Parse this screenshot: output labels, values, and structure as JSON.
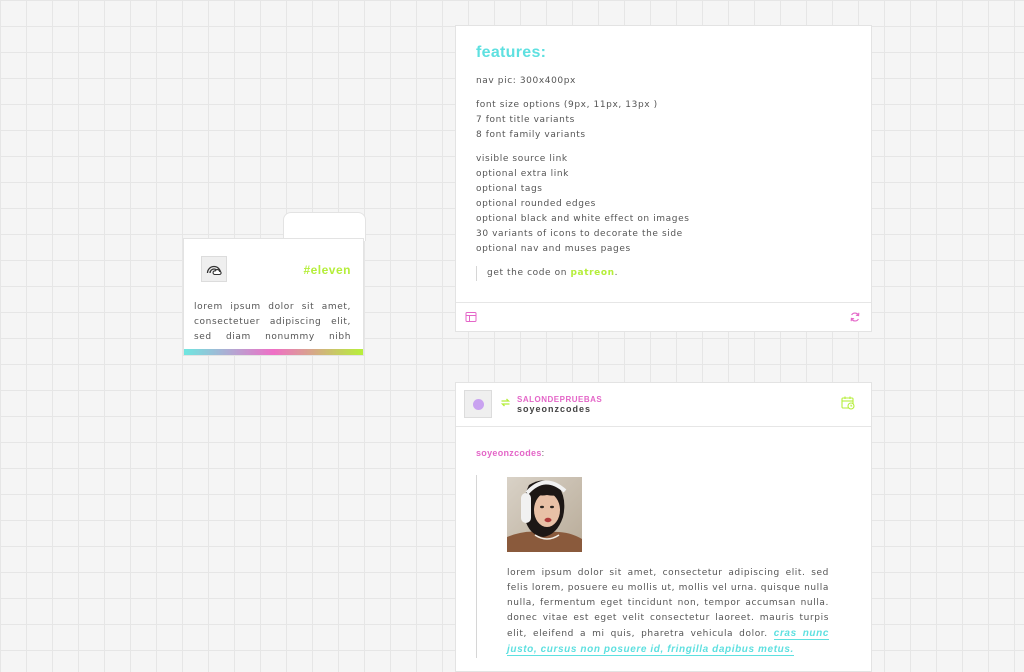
{
  "sidebar": {
    "title": "#eleven",
    "icon": "rainbow-cloud-icon",
    "description": "lorem ipsum dolor sit amet, consectetuer adipiscing elit, sed diam nonummy nibh"
  },
  "features_post": {
    "title": "features:",
    "group1": [
      "nav pic: 300x400px"
    ],
    "group2": [
      "font size options (9px, 11px, 13px )",
      "7 font title variants",
      "8 font family variants"
    ],
    "group3": [
      "visible source link",
      "optional extra link",
      "optional tags",
      "optional rounded edges",
      "optional black and white effect on images",
      "30 variants of icons to decorate the side",
      "optional nav and muses pages"
    ],
    "quote_prefix": "get the code on",
    "quote_link": "patreon",
    "quote_suffix": ".",
    "footer_left_icon": "archive-icon",
    "footer_right_icon": "reblog-icon"
  },
  "reblog_post": {
    "reblogger": "SALONDEPRUEBAS",
    "original_poster": "soyeonzcodes",
    "author_label": "soyeonzcodes",
    "author_suffix": ":",
    "header_icon": "calendar-icon",
    "body_text": "lorem ipsum dolor sit amet, consectetur adipiscing elit. sed felis lorem, posuere eu mollis ut, mollis vel urna. quisque nulla nulla, fermentum eget tincidunt non, tempor accumsan nulla. donec vitae est eget velit consectetur laoreet. mauris turpis elit, eleifend a mi quis, pharetra vehicula dolor.",
    "body_link": "cras nunc justo, cursus non posuere id, fringilla dapibus metus."
  },
  "colors": {
    "cyan": "#5ee0e0",
    "pink": "#e466c8",
    "lime": "#b5ee3a",
    "lavender": "#c9a2f0"
  }
}
